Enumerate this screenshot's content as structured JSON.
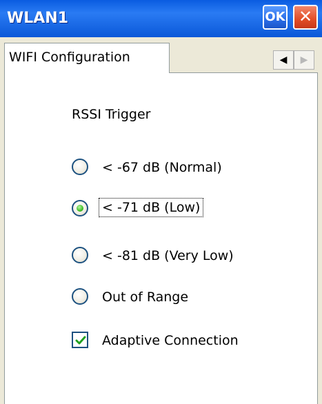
{
  "window": {
    "title": "WLAN1",
    "ok_label": "OK",
    "close_label": "✕"
  },
  "tabs": {
    "active_label": "WIFI Configuration",
    "scroll_left": "◀",
    "scroll_right": "▶"
  },
  "panel": {
    "section_label": "RSSI Trigger",
    "options": [
      {
        "label": "< -67 dB (Normal)",
        "checked": false
      },
      {
        "label": "< -71 dB (Low)",
        "checked": true
      },
      {
        "label": "< -81 dB (Very Low)",
        "checked": false
      },
      {
        "label": "Out of Range",
        "checked": false
      }
    ],
    "adaptive": {
      "label": "Adaptive Connection",
      "checked": true
    }
  }
}
